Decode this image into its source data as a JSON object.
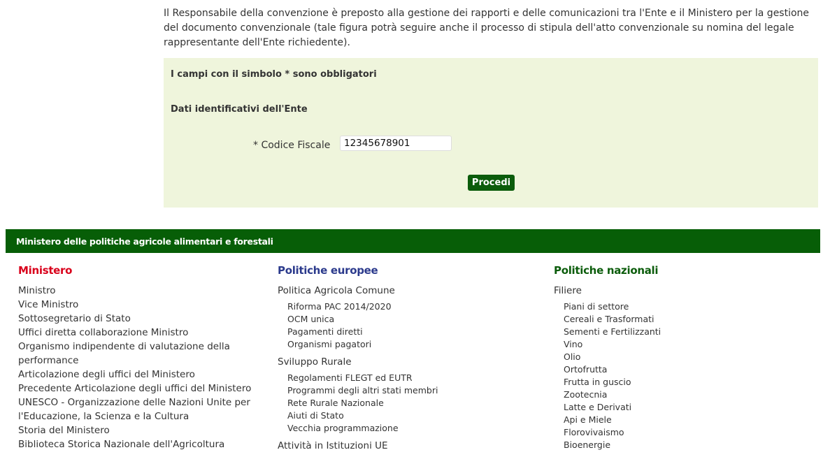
{
  "intro": "Il Responsabile della convenzione è preposto alla gestione dei rapporti e delle comunicazioni tra l'Ente e il Ministero per la gestione del documento convenzionale (tale figura potrà seguire anche il processo di stipula dell'atto convenzionale su nomina del legale rappresentante dell'Ente richiedente).",
  "form": {
    "required_note": "I campi con il simbolo * sono obbligatori",
    "section": "Dati identificativi dell'Ente",
    "cf_label": "* Codice Fiscale",
    "cf_value": "12345678901",
    "submit": "Procedi"
  },
  "footer": {
    "title": "Ministero delle politiche agricole alimentari e forestali",
    "ministero": {
      "heading": "Ministero",
      "color": "#d9001b",
      "items": [
        "Ministro",
        "Vice Ministro",
        "Sottosegretario di Stato",
        "Uffici diretta collaborazione Ministro",
        "Organismo indipendente di valutazione della performance",
        "Articolazione degli uffici del Ministero",
        "Precedente Articolazione degli uffici del Ministero",
        "UNESCO - Organizzazione delle Nazioni Unite per l'Educazione, la Scienza e la Cultura",
        "Storia del Ministero",
        "Biblioteca Storica Nazionale dell'Agricoltura"
      ]
    },
    "europee": {
      "heading": "Politiche europee",
      "color": "#2b3a8c",
      "groups": [
        {
          "label": "Politica Agricola Comune",
          "items": [
            "Riforma PAC 2014/2020",
            "OCM unica",
            "Pagamenti diretti",
            "Organismi pagatori"
          ]
        },
        {
          "label": "Sviluppo Rurale",
          "items": [
            "Regolamenti FLEGT ed EUTR",
            "Programmi degli altri stati membri",
            "Rete Rurale Nazionale",
            "Aiuti di Stato",
            "Vecchia programmazione"
          ]
        },
        {
          "label": "Attività in Istituzioni UE",
          "items": []
        }
      ]
    },
    "nazionali": {
      "heading": "Politiche nazionali",
      "color": "#0b5c0b",
      "groups": [
        {
          "label": "Filiere",
          "items": [
            "Piani di settore",
            "Cereali e Trasformati",
            "Sementi e Fertilizzanti",
            "Vino",
            "Olio",
            "Ortofrutta",
            "Frutta in guscio",
            "Zootecnia",
            "Latte e Derivati",
            "Api e Miele",
            "Florovivaismo",
            "Bioenergie"
          ]
        }
      ]
    }
  }
}
